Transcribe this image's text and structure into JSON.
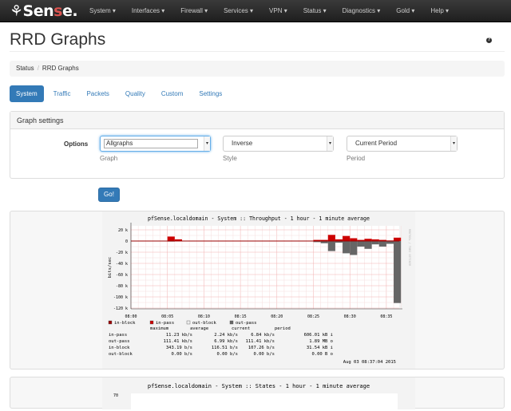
{
  "navbar": {
    "brand": "pfSense",
    "menu": [
      "System",
      "Interfaces",
      "Firewall",
      "Services",
      "VPN",
      "Status",
      "Diagnostics",
      "Gold",
      "Help"
    ]
  },
  "page": {
    "title": "RRD Graphs",
    "help_icon": "question-circle-icon"
  },
  "breadcrumb": [
    "Status",
    "RRD Graphs"
  ],
  "tabs": [
    "System",
    "Traffic",
    "Packets",
    "Quality",
    "Custom",
    "Settings"
  ],
  "settings": {
    "heading": "Graph settings",
    "options_label": "Options",
    "graph": {
      "value": "Allgraphs",
      "label": "Graph"
    },
    "style": {
      "value": "Inverse",
      "label": "Style"
    },
    "period": {
      "value": "Current Period",
      "label": "Period"
    },
    "go_label": "Go!"
  },
  "graph1": {
    "title": "pfSense.localdomain - System :: Throughput - 1 hour - 1 minute average",
    "ylabel": "bits/sec",
    "side_label": "RRDTOOL / TOBI OETIKER",
    "yticks": [
      "20 k",
      "0",
      "-20 k",
      "-40 k",
      "-60 k",
      "-80 k",
      "-100 k",
      "-120 k"
    ],
    "xticks": [
      "08:00",
      "08:05",
      "08:10",
      "08:15",
      "08:20",
      "08:25",
      "08:30",
      "08:35"
    ],
    "legend": [
      "in-block",
      "in-pass",
      "out-block",
      "out-pass"
    ],
    "legend_colors": [
      "#990000",
      "#cc0000",
      "#eeeeee",
      "#666666"
    ],
    "table_header": [
      "maximum",
      "average",
      "current",
      "period"
    ],
    "rows": [
      [
        "in-pass",
        "11.23 kb/s",
        "2.24 kb/s",
        "6.84 kb/s",
        "606.01 kB i"
      ],
      [
        "out-pass",
        "111.41 kb/s",
        "6.99 kb/s",
        "111.41 kb/s",
        "1.89 MB o"
      ],
      [
        "in-block",
        "343.19  b/s",
        "116.51  b/s",
        "107.26  b/s",
        "31.54 kB i"
      ],
      [
        "out-block",
        "0.00  b/s",
        "0.00  b/s",
        "0.00  b/s",
        "0.00  B o"
      ]
    ],
    "timestamp": "Aug 03 08:37:04 2015",
    "chart_data": {
      "type": "bar",
      "x_unit": "minutes after 08:00",
      "ylim": [
        -120,
        20
      ],
      "y_unit": "k bits/sec",
      "x": [
        5,
        6,
        25,
        26,
        27,
        28,
        29,
        30,
        31,
        32,
        33,
        34,
        35,
        36
      ],
      "series": [
        {
          "name": "in-pass",
          "values": [
            8,
            3,
            2,
            2,
            11,
            3,
            9,
            5,
            2,
            4,
            3,
            2,
            1,
            6
          ]
        },
        {
          "name": "out-pass",
          "values": [
            -1,
            0,
            -2,
            -4,
            -18,
            -3,
            -22,
            -25,
            -10,
            -14,
            -6,
            -10,
            -5,
            -111
          ]
        }
      ]
    }
  },
  "graph2": {
    "title": "pfSense.localdomain - System :: States - 1 hour - 1 minute average",
    "first_ytick": "70"
  }
}
